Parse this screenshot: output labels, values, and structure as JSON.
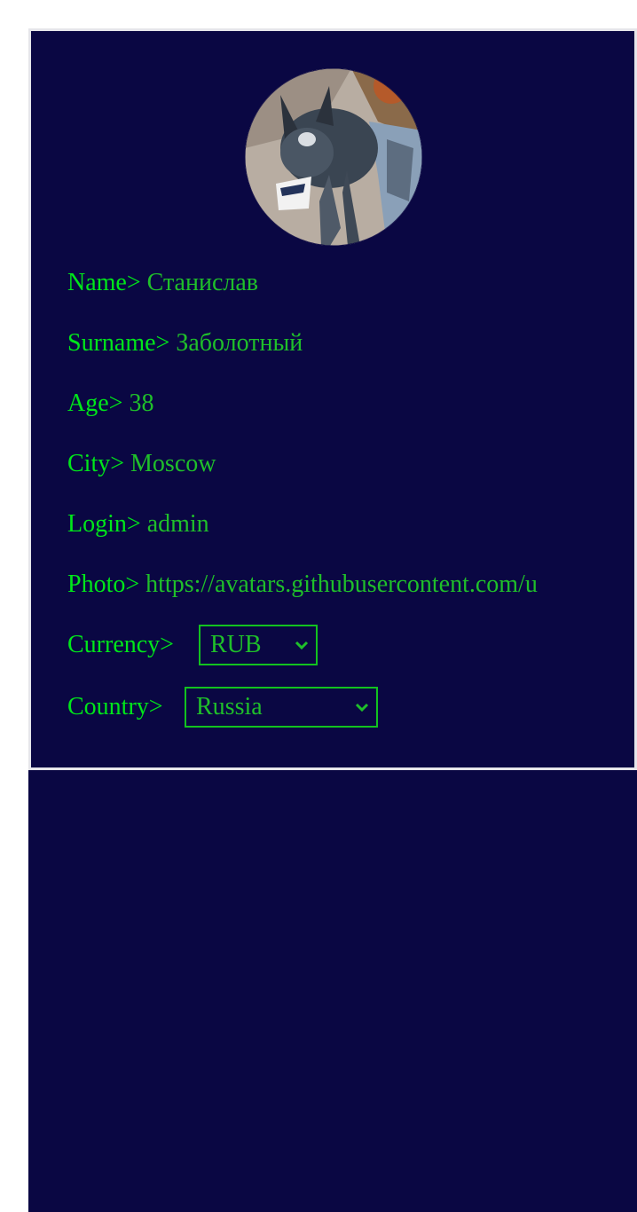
{
  "profile": {
    "name_label": "Name>",
    "name_value": "Станислав",
    "surname_label": "Surname>",
    "surname_value": "Заболотный",
    "age_label": "Age>",
    "age_value": "38",
    "city_label": "City>",
    "city_value": "Moscow",
    "login_label": "Login>",
    "login_value": "admin",
    "photo_label": "Photo>",
    "photo_value": "https://avatars.githubusercontent.com/u",
    "currency_label": "Currency>",
    "currency_value": "RUB",
    "country_label": "Country>",
    "country_value": "Russia"
  },
  "icons": {
    "avatar": "dog-photo-avatar",
    "dropdown": "chevron-down-icon"
  },
  "colors": {
    "background": "#0a0743",
    "label": "#00e61a",
    "value": "#1fbf2a",
    "border": "#e6e6ea"
  }
}
